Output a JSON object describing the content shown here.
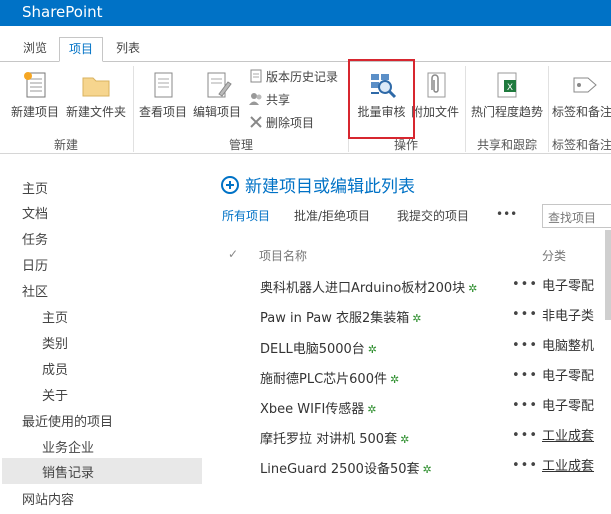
{
  "app": {
    "brand": "SharePoint"
  },
  "tabs": [
    {
      "label": "浏览"
    },
    {
      "label": "项目"
    },
    {
      "label": "列表"
    }
  ],
  "ribbon": {
    "groups": {
      "new": "新建",
      "manage": "管理",
      "actions": "操作",
      "share": "共享和跟踪",
      "tags": "标签和备注"
    },
    "buttons": {
      "new_item": "新建项目",
      "new_folder": "新建文件夹",
      "view_item": "查看项目",
      "edit_item": "编辑项目",
      "version_history": "版本历史记录",
      "share": "共享",
      "delete_item": "删除项目",
      "batch_review": "批量审核",
      "attach_file": "附加文件",
      "hot_trend": "热门程度趋势",
      "tags_notes": "标签和备注"
    }
  },
  "nav": {
    "items": [
      {
        "label": "主页"
      },
      {
        "label": "文档"
      },
      {
        "label": "任务"
      },
      {
        "label": "日历"
      },
      {
        "label": "社区"
      },
      {
        "label": "主页"
      },
      {
        "label": "类别"
      },
      {
        "label": "成员"
      },
      {
        "label": "关于"
      },
      {
        "label": "最近使用的项目"
      },
      {
        "label": "业务企业"
      },
      {
        "label": "销售记录"
      },
      {
        "label": "网站内容"
      }
    ]
  },
  "main": {
    "new_item": {
      "part1": "新建项目或",
      "part2": "编辑",
      "part3": "此列表"
    },
    "views": {
      "all": "所有项目",
      "approve": "批准/拒绝项目",
      "mine": "我提交的项目",
      "more": "•••"
    },
    "search_placeholder": "查找项目",
    "columns": {
      "check": "✓",
      "title": "项目名称",
      "category": "分类"
    },
    "rows": [
      {
        "title": "奥科机器人进口Arduino板材200块",
        "category": "电子零配"
      },
      {
        "title": "Paw in Paw 衣服2集装箱",
        "category": "非电子类"
      },
      {
        "title": "DELL电脑5000台",
        "category": "电脑整机"
      },
      {
        "title": "施耐德PLC芯片600件",
        "category": "电子零配"
      },
      {
        "title": "Xbee WIFI传感器",
        "category": "电子零配"
      },
      {
        "title": "摩托罗拉 对讲机 500套",
        "category": "工业成套"
      },
      {
        "title": "LineGuard 2500设备50套",
        "category": "工业成套"
      }
    ],
    "row_more": "•••",
    "new_mark": "✲"
  },
  "colors": {
    "brand": "#0072c6",
    "highlight": "#d7262f"
  }
}
